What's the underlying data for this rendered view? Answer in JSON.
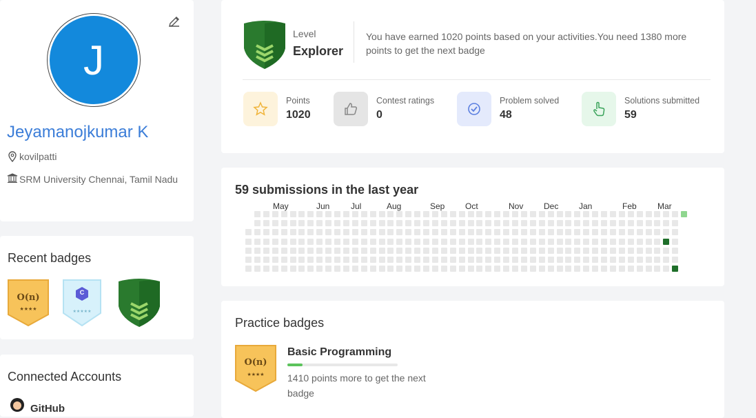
{
  "profile": {
    "avatar_letter": "J",
    "name": "Jeyamanojkumar K",
    "location": "kovilpatti",
    "institution": "SRM University Chennai, Tamil Nadu"
  },
  "recent_badges": {
    "title": "Recent badges",
    "items": [
      {
        "icon": "complexity-badge",
        "text": "O(n)",
        "stars": "★★★★"
      },
      {
        "icon": "c-language-badge",
        "text": "C",
        "stars": "★★★★★"
      },
      {
        "icon": "explorer-shield-badge",
        "text": "",
        "stars": ""
      }
    ]
  },
  "connected": {
    "title": "Connected Accounts",
    "github_label": "GitHub"
  },
  "level": {
    "label": "Level",
    "name": "Explorer",
    "message": "You have earned 1020 points based on your activities.You need 1380 more points to get the next badge"
  },
  "stats": [
    {
      "label": "Points",
      "value": "1020",
      "icon": "star-icon",
      "color": "#fdf3dc"
    },
    {
      "label": "Contest ratings",
      "value": "0",
      "icon": "thumbs-up-icon",
      "color": "#e5e5e5"
    },
    {
      "label": "Problem solved",
      "value": "48",
      "icon": "check-circle-icon",
      "color": "#e4eafc"
    },
    {
      "label": "Solutions submitted",
      "value": "59",
      "icon": "hand-pointer-icon",
      "color": "#e6f7ea"
    }
  ],
  "submissions": {
    "title": "59 submissions in the last year",
    "months": [
      "May",
      "Jun",
      "Jul",
      "Aug",
      "Sep",
      "Oct",
      "Nov",
      "Dec",
      "Jan",
      "Feb",
      "Mar"
    ],
    "active_cells": [
      {
        "week": 49,
        "day": 0,
        "level": "light"
      },
      {
        "week": 47,
        "day": 3,
        "level": "dark"
      },
      {
        "week": 48,
        "day": 6,
        "level": "dark"
      }
    ]
  },
  "practice": {
    "title": "Practice badges",
    "badge_name": "Basic Programming",
    "badge_text": "O(n)",
    "badge_stars": "★★★★",
    "progress_fraction": 0.14,
    "remaining": "1410 points more to get the next badge"
  },
  "colors": {
    "name_blue": "#3b7dd8",
    "avatar_blue": "#1389dc",
    "green_dark": "#1f6f2a",
    "green_light": "#8fd68f"
  }
}
